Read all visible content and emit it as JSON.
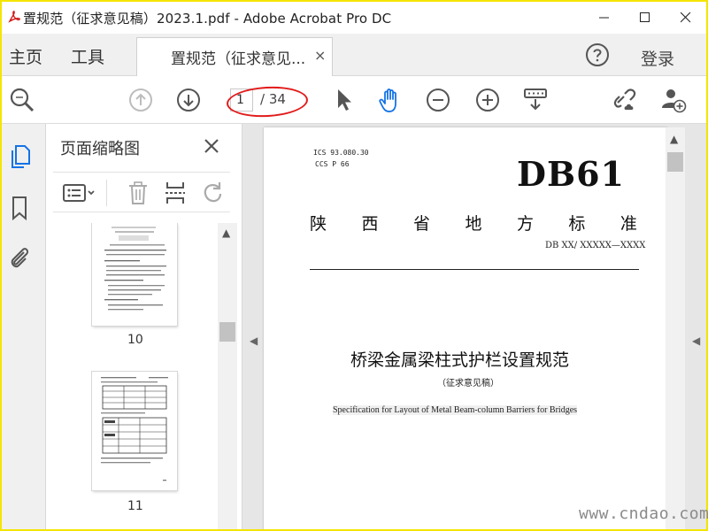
{
  "window": {
    "title": "置规范（征求意见稿）2023.1.pdf - Adobe Acrobat Pro DC"
  },
  "tabbar": {
    "home": "主页",
    "tools": "工具",
    "doc_tab_label": "置规范（征求意见...",
    "doc_tab_close": "×",
    "login": "登录"
  },
  "toolbar": {
    "page_current": "1",
    "page_total": "/ 34"
  },
  "thumbnail_panel": {
    "title": "页面缩略图",
    "pages": [
      {
        "label": "10"
      },
      {
        "label": "11"
      }
    ]
  },
  "document": {
    "ics": "ICS 93.080.30",
    "ccs": "CCS P 66",
    "code": "DB61",
    "standard_type_chars": [
      "陕",
      "西",
      "省",
      "地",
      "方",
      "标",
      "准"
    ],
    "standard_number": "DB XX/ XXXXX—XXXX",
    "title_cn": "桥梁金属梁柱式护栏设置规范",
    "subtitle": "（征求意见稿）",
    "title_en": "Specification for Layout of Metal Beam-column Barriers for Bridges"
  },
  "watermark": "www.cndao.com",
  "colors": {
    "frame": "#f4e500",
    "accent_blue": "#1473e6",
    "annotation_red": "#e21b1b"
  }
}
